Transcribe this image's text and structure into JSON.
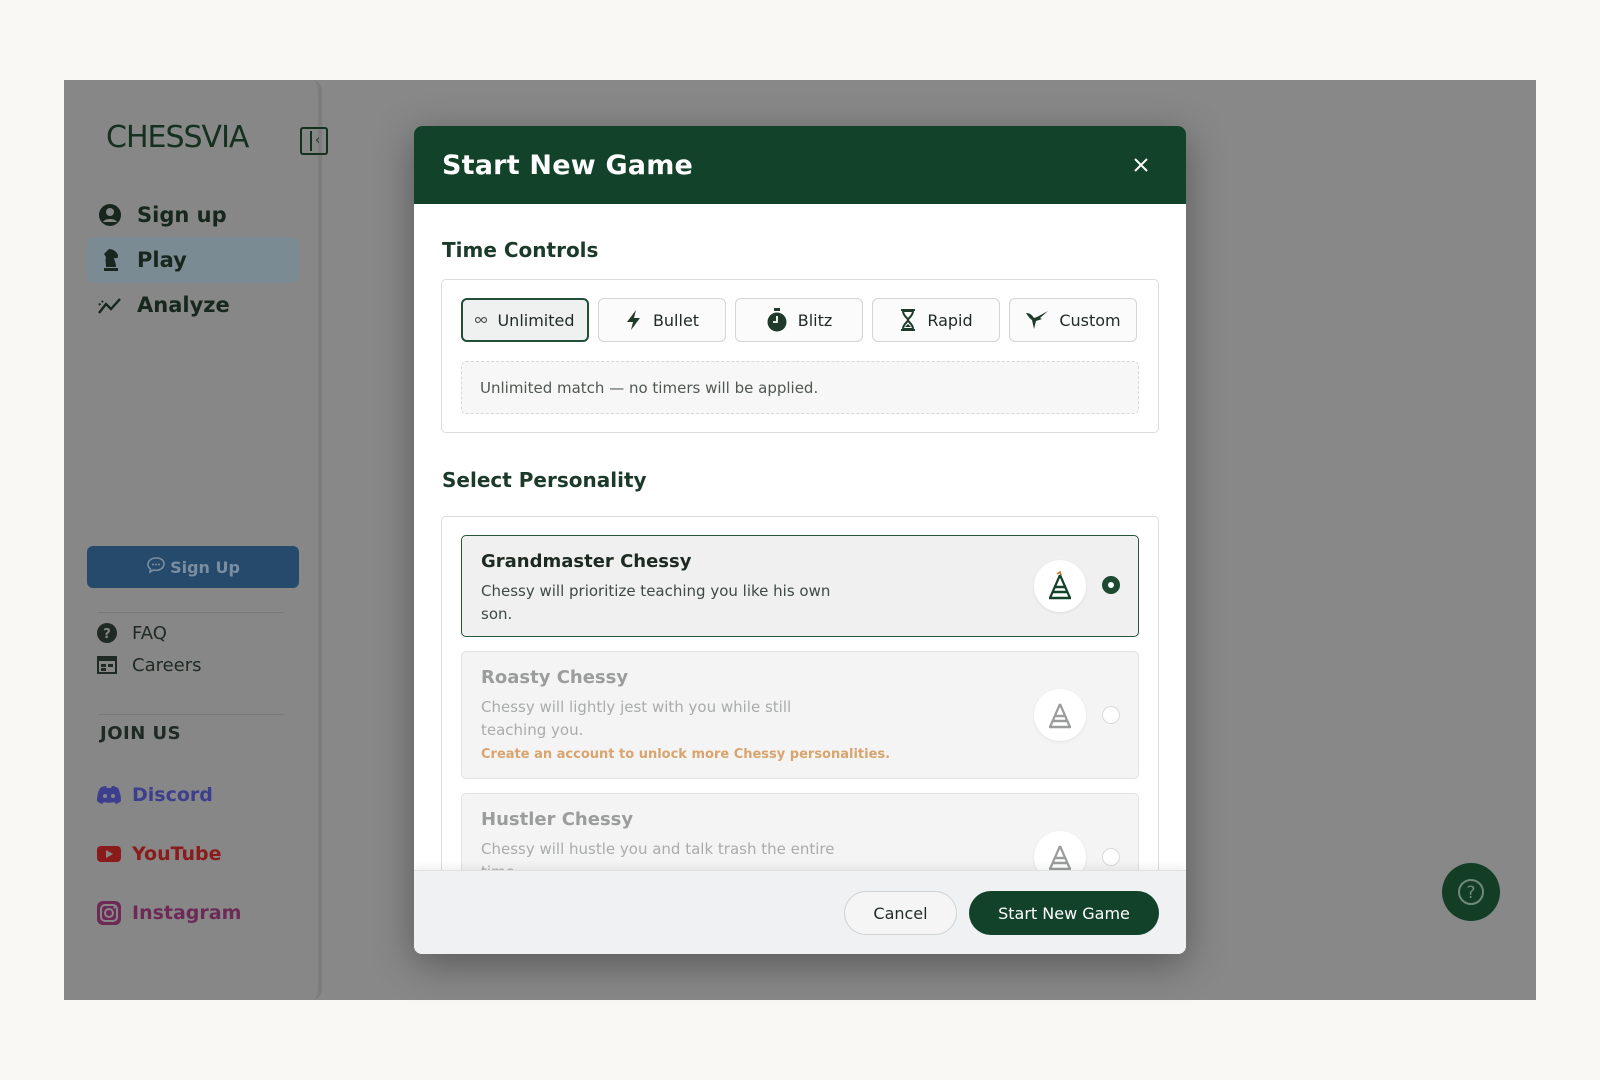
{
  "app": {
    "brand": "CHESSVIA"
  },
  "sidebar": {
    "nav": [
      {
        "label": "Sign up",
        "icon": "user-circle-icon"
      },
      {
        "label": "Play",
        "icon": "knight-icon"
      },
      {
        "label": "Analyze",
        "icon": "chart-line-icon"
      }
    ],
    "cta_label": "Sign Up",
    "links": [
      {
        "label": "FAQ",
        "icon": "question-circle-icon"
      },
      {
        "label": "Careers",
        "icon": "calendar-table-icon"
      }
    ],
    "join_us": "JOIN US",
    "socials": [
      {
        "label": "Discord",
        "icon": "discord-icon",
        "color": "#3d3f8e"
      },
      {
        "label": "YouTube",
        "icon": "youtube-icon",
        "color": "#8a1b1b"
      },
      {
        "label": "Instagram",
        "icon": "instagram-icon",
        "color": "#6e2a56"
      }
    ]
  },
  "modal": {
    "title": "Start New Game",
    "time_controls": {
      "heading": "Time Controls",
      "options": [
        {
          "label": "Unlimited",
          "icon": "infinity-icon",
          "selected": true
        },
        {
          "label": "Bullet",
          "icon": "lightning-icon",
          "selected": false
        },
        {
          "label": "Blitz",
          "icon": "stopwatch-icon",
          "selected": false
        },
        {
          "label": "Rapid",
          "icon": "hourglass-icon",
          "selected": false
        },
        {
          "label": "Custom",
          "icon": "hummingbird-icon",
          "selected": false
        }
      ],
      "note": "Unlimited match — no timers will be applied."
    },
    "personality": {
      "heading": "Select Personality",
      "options": [
        {
          "name": "Grandmaster Chessy",
          "desc": "Chessy will prioritize teaching you like his own son.",
          "selected": true,
          "locked": false
        },
        {
          "name": "Roasty Chessy",
          "desc": "Chessy will lightly jest with you while still teaching you.",
          "note": "Create an account to unlock more Chessy personalities.",
          "selected": false,
          "locked": true
        },
        {
          "name": "Hustler Chessy",
          "desc": "Chessy will hustle you and talk trash the entire time.",
          "selected": false,
          "locked": true
        }
      ]
    },
    "footer": {
      "cancel": "Cancel",
      "start": "Start New Game"
    }
  },
  "colors": {
    "brand_green": "#13422a",
    "accent_orange": "#d9a46d"
  }
}
